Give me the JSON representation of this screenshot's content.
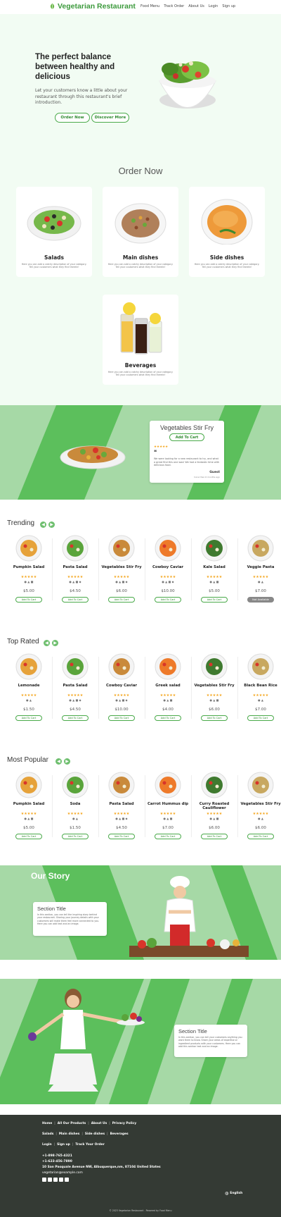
{
  "header": {
    "brand": "Vegetarian Restaurant",
    "nav": [
      "Food Menu",
      "Track Order",
      "About Us",
      "Login",
      "Sign up"
    ]
  },
  "hero": {
    "title": "The perfect balance between healthy and delicious",
    "text": "Let your customers know a little about your restaurant through this restaurant's brief introduction.",
    "btn_order": "Order Now",
    "btn_discover": "Discover More"
  },
  "order": {
    "title": "Order Now",
    "categories": [
      {
        "name": "Salads",
        "desc": "Here you can add a catchy description of your category. Tell your customers what they find therein!"
      },
      {
        "name": "Main dishes",
        "desc": "Here you can add a catchy description of your category. Tell your customers what they find therein!"
      },
      {
        "name": "Side dishes",
        "desc": "Here you can add a catchy description of your category. Tell your customers what they find therein!"
      },
      {
        "name": "Beverages",
        "desc": "Here you can add a catchy description of your category. Tell your customers what they find therein!"
      }
    ]
  },
  "promo": {
    "title": "Vegetables Stir Fry",
    "btn": "Add To Cart",
    "stars": "★★★★★",
    "quote_mark": "❝",
    "review": "We were looking for a new restaurant to try, and what a great find this one was! We had a fantastic time with delicious food.",
    "author": "Guest",
    "time": "more than 6 months ago"
  },
  "trending": {
    "title": "Trending",
    "items": [
      {
        "name": "Pumpkin Salad",
        "stars": "★★★★★",
        "diet": "● ▲ ■",
        "price": "$5.00",
        "btn": "Add To Cart"
      },
      {
        "name": "Pasta Salad",
        "stars": "★★★★★",
        "diet": "● ▲ ■ ◆",
        "price": "$4.50",
        "btn": "Add To Cart"
      },
      {
        "name": "Vegetables Stir Fry",
        "stars": "★★★★★",
        "diet": "● ▲ ■ ◆",
        "price": "$6.00",
        "btn": "Add To Cart"
      },
      {
        "name": "Cowboy Caviar",
        "stars": "★★★★★",
        "diet": "● ▲ ■ ◆",
        "price": "$10.00",
        "btn": "Add To Cart"
      },
      {
        "name": "Kale Salad",
        "stars": "★★★★★",
        "diet": "● ▲ ■",
        "price": "$5.00",
        "btn": "Add To Cart"
      },
      {
        "name": "Veggie Pasta",
        "stars": "★★★★★",
        "diet": "● ▲",
        "price": "$7.00",
        "btn": "Not Available"
      }
    ]
  },
  "toprated": {
    "title": "Top Rated",
    "items": [
      {
        "name": "Lemonade",
        "stars": "★★★★★",
        "diet": "● ▲",
        "price": "$1.50",
        "btn": "Add To Cart"
      },
      {
        "name": "Pasta Salad",
        "stars": "★★★★★",
        "diet": "● ▲ ■ ◆",
        "price": "$4.50",
        "btn": "Add To Cart"
      },
      {
        "name": "Cowboy Caviar",
        "stars": "★★★★★",
        "diet": "● ▲ ■ ◆",
        "price": "$10.00",
        "btn": "Add To Cart"
      },
      {
        "name": "Greek salad",
        "stars": "★★★★★",
        "diet": "● ▲ ■",
        "price": "$4.00",
        "btn": "Add To Cart"
      },
      {
        "name": "Vegetables Stir Fry",
        "stars": "★★★★★",
        "diet": "● ▲ ■",
        "price": "$6.00",
        "btn": "Add To Cart"
      },
      {
        "name": "Black Bean Rice",
        "stars": "★★★★★",
        "diet": "● ▲",
        "price": "$7.00",
        "btn": "Add To Cart"
      }
    ]
  },
  "popular": {
    "title": "Most Popular",
    "items": [
      {
        "name": "Pumpkin Salad",
        "stars": "★★★★★",
        "diet": "● ▲ ■",
        "price": "$5.00",
        "btn": "Add To Cart"
      },
      {
        "name": "Soda",
        "stars": "★★★★★",
        "diet": "● ▲",
        "price": "$1.50",
        "btn": "Add To Cart"
      },
      {
        "name": "Pasta Salad",
        "stars": "★★★★★",
        "diet": "● ▲ ■ ◆",
        "price": "$4.50",
        "btn": "Add To Cart"
      },
      {
        "name": "Carrot Hummus dip",
        "stars": "★★★★★",
        "diet": "● ▲ ■",
        "price": "$7.00",
        "btn": "Add To Cart"
      },
      {
        "name": "Curry Roasted Cauliflower",
        "stars": "★★★★★",
        "diet": "● ▲ ■",
        "price": "$6.00",
        "btn": "Add To Cart"
      },
      {
        "name": "Vegetables Stir Fry",
        "stars": "★★★★★",
        "diet": "● ▲",
        "price": "$6.00",
        "btn": "Add To Cart"
      }
    ]
  },
  "story": {
    "heading": "Our Story",
    "card_title": "Section Title",
    "card_text": "In this section, you can tell the inspiring story behind your restaurant. Sharing your journey details with your customers will make them feel more connected to you. Here you can add text and an image."
  },
  "story2": {
    "card_title": "Section Title",
    "card_text": "In this section, you can tell your customers anything you want them to know. Share your areas of expertise or ingredient products with your customers. Here you can add this section text and an image."
  },
  "footer": {
    "row1": [
      "Home",
      "All Our Products",
      "About Us",
      "Privacy Policy"
    ],
    "row2": [
      "Salads",
      "Main dishes",
      "Side dishes",
      "Beverages"
    ],
    "row3": [
      "Login",
      "Sign up",
      "Track Your Order"
    ],
    "phone1": "+1-898-765-4321",
    "phone2": "+1-623-456-7890",
    "address": "10 San Pasquale Avenue NW, Albuquerque,nm, 87104 United States",
    "email": "vegetarian@example.com",
    "language": "English",
    "copyright": "© 2023 Vegetarian Restaurant . Powered by Food Menu"
  },
  "colors": {
    "brand": "#3c9a3c",
    "accent_bg": "#a6d9a6",
    "stripe": "#5cbf5c",
    "footer_bg": "#343a34",
    "star": "#f4a51c"
  }
}
